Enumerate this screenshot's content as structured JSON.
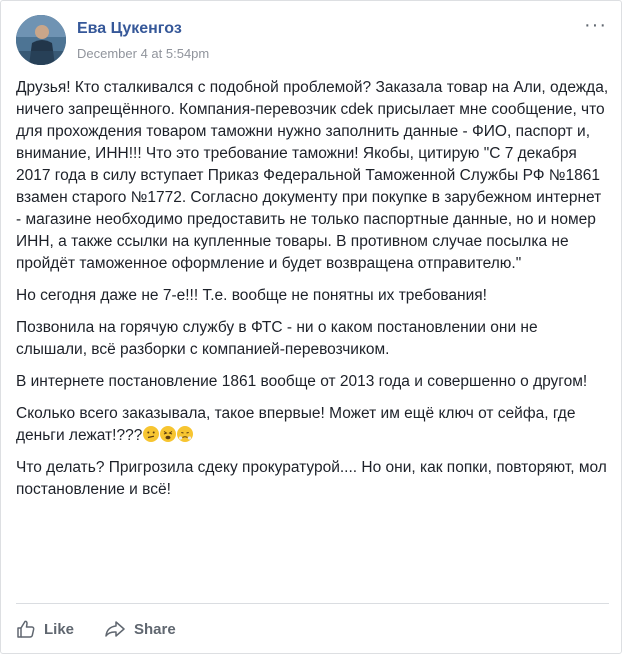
{
  "post": {
    "author": "Ева Цукенгоз",
    "timestamp": "December 4 at 5:54pm",
    "more_icon": "ellipsis-icon",
    "paragraphs": [
      "Друзья! Кто сталкивался с подобной проблемой? Заказала товар на Али, одежда, ничего запрещённого. Компания-перевозчик cdek присылает мне сообщение, что для прохождения товаром таможни нужно заполнить данные - ФИО, паспорт и, внимание, ИНН!!! Что это требование таможни! Якобы, цитирую \"С 7 декабря 2017 года в силу вступает Приказ Федеральной Таможенной Службы РФ №1861 взамен старого №1772. Согласно документу при покупке в зарубежном интернет - магазине необходимо предоставить не только паспортные данные, но и номер ИНН, а также ссылки на купленные товары. В противном случае посылка не пройдёт таможенное оформление и будет возвращена отправителю.\"",
      "Но сегодня даже не 7-е!!! Т.е. вообще не понятны их требования!",
      "Позвонила на горячую службу в ФТС - ни о каком постановлении они не слышали, всё разборки с компанией-перевозчиком.",
      "В интернете постановление 1861 вообще от 2013 года и совершенно о другом!",
      "Сколько всего заказывала, такое впервые! Может им ещё ключ от сейфа, где деньги лежат!???",
      "Что делать? Пригрозила сдеку прокуратурой.... Но они, как попки, повторяют, мол постановление и всё!"
    ],
    "emojis": [
      "confused-face-icon",
      "tired-face-icon",
      "steam-nose-face-icon"
    ]
  },
  "actions": {
    "like_label": "Like",
    "share_label": "Share"
  },
  "colors": {
    "author_link": "#365899",
    "meta_text": "#90949c",
    "body_text": "#1d2129",
    "action_text": "#606770",
    "emoji_yellow": "#f7c531"
  }
}
